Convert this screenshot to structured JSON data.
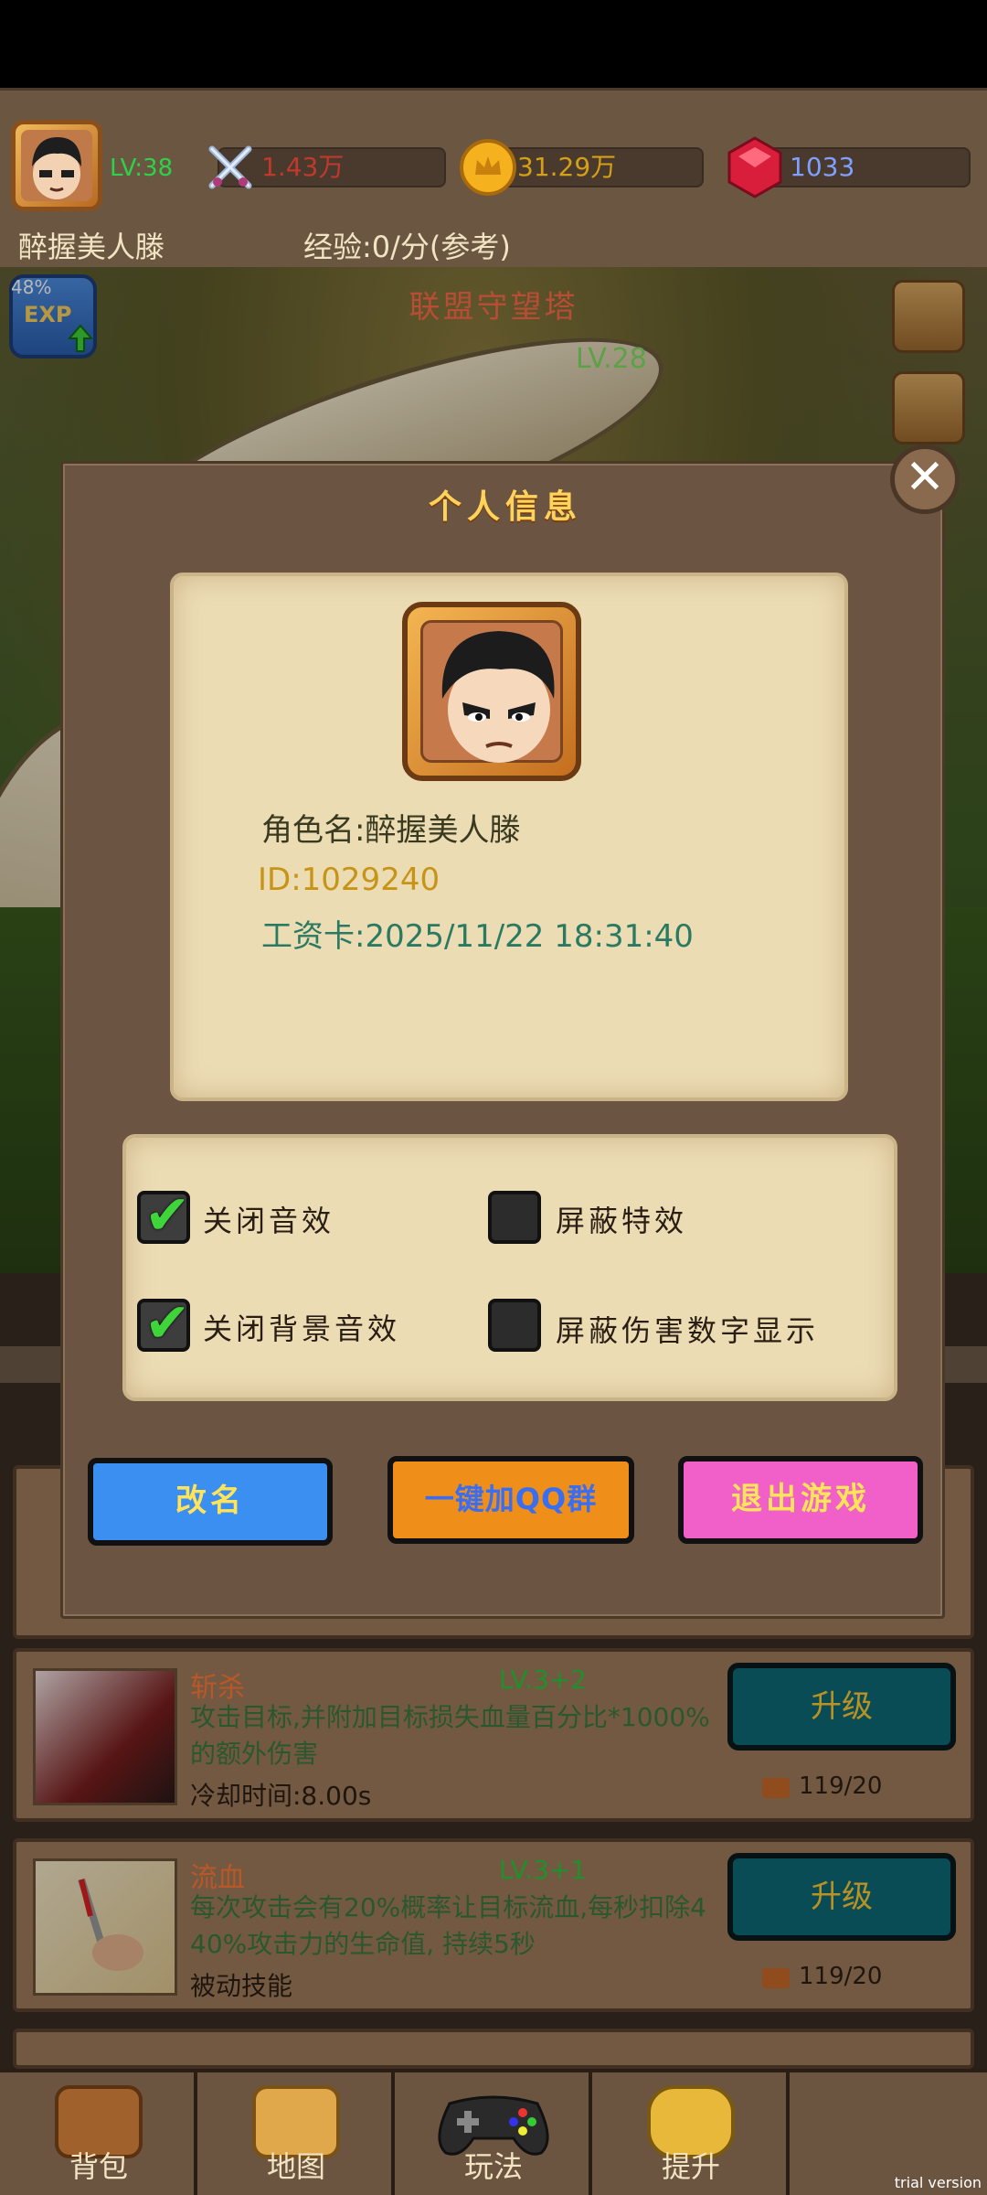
{
  "top_bar": {
    "level": "LV:38",
    "power": "1.43万",
    "gold": "31.29万",
    "gems": "1033",
    "player_name": "醉握美人滕",
    "exp_rate": "经验:0/分(参考)"
  },
  "scene": {
    "title": "联盟守望塔",
    "level": "LV.28",
    "exp_percent": "48%",
    "exp_badge": "EXP"
  },
  "dialog": {
    "title": "个人信息",
    "role_name": "角色名:醉握美人滕",
    "id": "ID:1029240",
    "wage_card": "工资卡:2025/11/22 18:31:40",
    "options": [
      {
        "label": "关闭音效",
        "checked": true
      },
      {
        "label": "屏蔽特效",
        "checked": false
      },
      {
        "label": "关闭背景音效",
        "checked": true
      },
      {
        "label": "屏蔽伤害数字显示",
        "checked": false
      }
    ],
    "rename_label": "改名",
    "qq_label": "一键加QQ群",
    "quit_label": "退出游戏"
  },
  "skills": [
    {
      "name": "斩杀",
      "level": "LV.3+2",
      "desc_line1": "攻击目标,并附加目标损失血量百分比*1000%",
      "desc_line2": "的额外伤害",
      "cooldown": "冷却时间:8.00s",
      "upgrade_label": "升级",
      "cost": "119/20"
    },
    {
      "name": "流血",
      "level": "LV.3+1",
      "desc_line1": "每次攻击会有20%概率让目标流血,每秒扣除4",
      "desc_line2": "40%攻击力的生命值, 持续5秒",
      "cooldown": "被动技能",
      "upgrade_label": "升级",
      "cost": "119/20"
    }
  ],
  "nav": [
    {
      "label": "背包",
      "icon": "backpack-icon"
    },
    {
      "label": "地图",
      "icon": "map-icon"
    },
    {
      "label": "玩法",
      "icon": "gamepad-icon"
    },
    {
      "label": "提升",
      "icon": "fist-icon"
    },
    {
      "label": "",
      "icon": "empty"
    }
  ],
  "watermark": "trial version",
  "colors": {
    "rename_button": "#3a8ff0",
    "qq_button": "#ef8f1a",
    "quit_button": "#f060c8",
    "panel": "#6b5441",
    "parchment": "#ecdcb4"
  }
}
